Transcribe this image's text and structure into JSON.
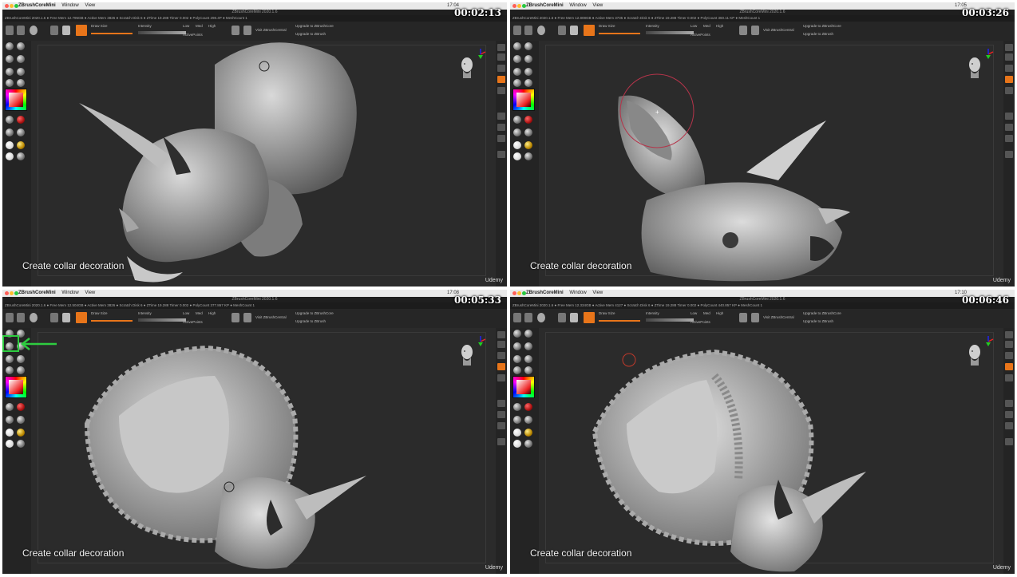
{
  "app": {
    "name": "ZBrushCoreMini",
    "menus": [
      "Window",
      "View"
    ],
    "window_title": "ZBrushCoreMini 2020.1.6"
  },
  "toolbar": {
    "draw_size_label": "Draw Size",
    "intensity_label": "Intensity",
    "active_points_label": "ActivePoints",
    "low_label": "Low",
    "med_label": "Med",
    "high_label": "High",
    "visit_label": "Visit ZBrushCentral",
    "upgrade_core_label": "Upgrade to ZBrushCore",
    "upgrade_zbrush_label": "Upgrade to ZBrush"
  },
  "panels": [
    {
      "timestamp": "00:02:13",
      "caption": "Create collar decoration",
      "info": "ZBrushCoreMini 2020.1.6  ● Free Mem 12.795GB ● Active Mem 3826 ● Scratch Disk 6 ● ZTime 19.288 Timer 0.002 ● PolyCount 298.4P ● MeshCount 1",
      "sys_time": "17:04",
      "watermark": "Udemy"
    },
    {
      "timestamp": "00:03:26",
      "caption": "Create collar decoration",
      "info": "ZBrushCoreMini 2020.1.6  ● Free Mem 12.808GB ● Active Mem 3735 ● Scratch Disk 6 ● ZTime 19.288 Timer 0.002 ● PolyCount 360.11 KP ● MeshCount 1",
      "sys_time": "17:05",
      "watermark": "Udemy"
    },
    {
      "timestamp": "00:05:33",
      "caption": "Create collar decoration",
      "info": "ZBrushCoreMini 2020.1.6  ● Free Mem 12.504GB ● Active Mem 3826 ● Scratch Disk 6 ● ZTime 19.288 Timer 0.002 ● PolyCount 377.867 KP ● MeshCount 1",
      "sys_time": "17:08",
      "watermark": "Udemy"
    },
    {
      "timestamp": "00:06:46",
      "caption": "Create collar decoration",
      "info": "ZBrushCoreMini 2020.1.6  ● Free Mem 12.334GB ● Active Mem 4127 ● Scratch Disk 6 ● ZTime 19.288 Timer 0.002 ● PolyCount 440.857 KP ● MeshCount 1",
      "sys_time": "17:10",
      "watermark": "Udemy"
    }
  ],
  "colors": {
    "ui_accent": "#e8751a",
    "highlight_arrow": "#2ecc40",
    "brush_cursor": "#c0392b"
  },
  "icons": [
    "apple-icon",
    "draw-mode-icon",
    "move-icon",
    "material-sphere-icon",
    "color-picker-icon",
    "head-navigation-icon",
    "axis-gizmo-icon",
    "green-arrow-icon"
  ]
}
